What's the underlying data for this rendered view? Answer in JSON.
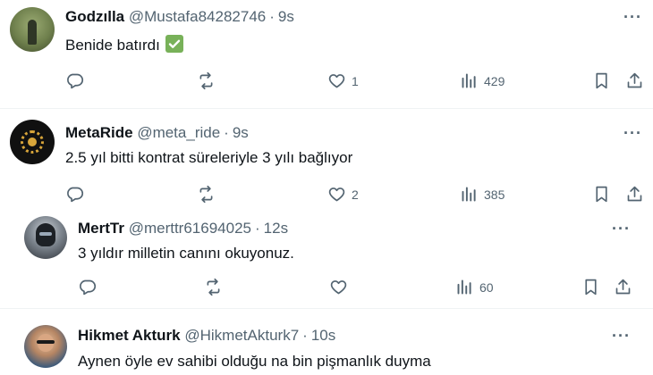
{
  "tweets": [
    {
      "name": "Godzılla",
      "handle": "@Mustafa84282746",
      "time": "9s",
      "text": "Benide batırdı",
      "emoji": "check-mark-emoji",
      "likes": "1",
      "views": "429"
    },
    {
      "name": "MetaRide",
      "handle": "@meta_ride",
      "time": "9s",
      "text": "2.5 yıl bitti kontrat süreleriyle 3 yılı bağlıyor",
      "likes": "2",
      "views": "385"
    },
    {
      "name": "MertTr",
      "handle": "@merttr61694025",
      "time": "12s",
      "text": "3 yıldır milletin canını okuyonuz.",
      "likes": "",
      "views": "60"
    },
    {
      "name": "Hikmet Akturk",
      "handle": "@HikmetAkturk7",
      "time": "10s",
      "text": "Aynen öyle ev sahibi olduğu na bin pişmanlık duyma"
    }
  ],
  "separator": "·",
  "more_label": "···",
  "colors": {
    "text": "#0f1419",
    "secondary": "#536471",
    "divider": "#eff3f4",
    "check": "#78b159"
  }
}
